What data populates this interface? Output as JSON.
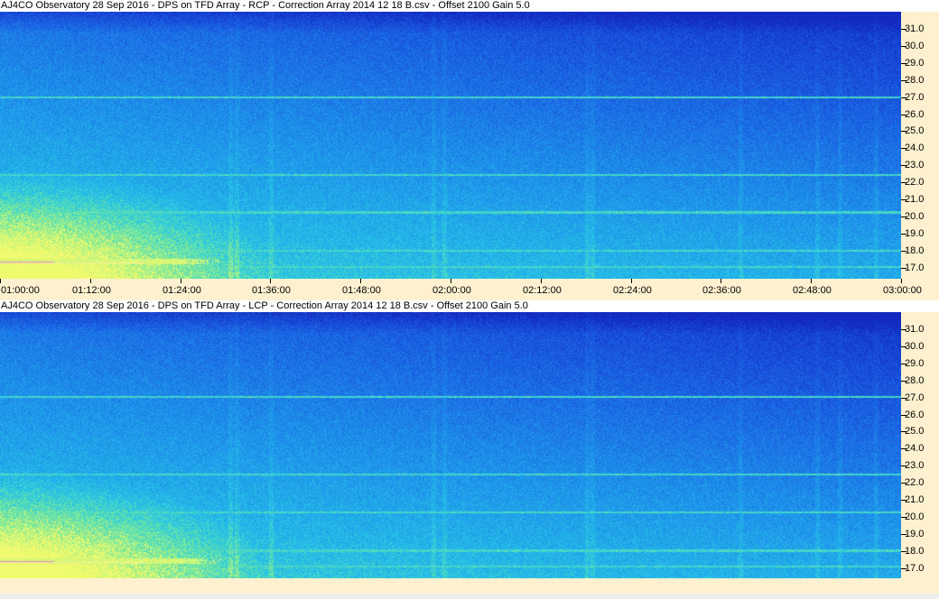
{
  "panels": [
    {
      "title": "AJ4CO Observatory 28 Sep 2016  -  DPS on TFD Array  -  RCP  -  Correction Array 2014 12 18 B.csv  -  Offset 2100  Gain 5.0"
    },
    {
      "title": "AJ4CO Observatory 28 Sep 2016  -  DPS on TFD Array  -  LCP  -  Correction Array 2014 12 18 B.csv  -  Offset 2100  Gain 5.0"
    }
  ],
  "frequency_axis": {
    "labels": [
      "31.0",
      "30.0",
      "29.0",
      "28.0",
      "27.0",
      "26.0",
      "25.0",
      "24.0",
      "23.0",
      "22.0",
      "21.0",
      "20.0",
      "19.0",
      "18.0",
      "17.0"
    ]
  },
  "time_axis": {
    "labels": [
      "01:00:00",
      "01:12:00",
      "01:24:00",
      "01:36:00",
      "01:48:00",
      "02:00:00",
      "02:12:00",
      "02:24:00",
      "02:36:00",
      "02:48:00",
      "03:00:00"
    ]
  },
  "colors": {
    "background": "#fff1cf",
    "spectrogram_low": "#1a3fd0",
    "spectrogram_mid": "#1f9ee8",
    "spectrogram_high": "#9cf07a"
  }
}
